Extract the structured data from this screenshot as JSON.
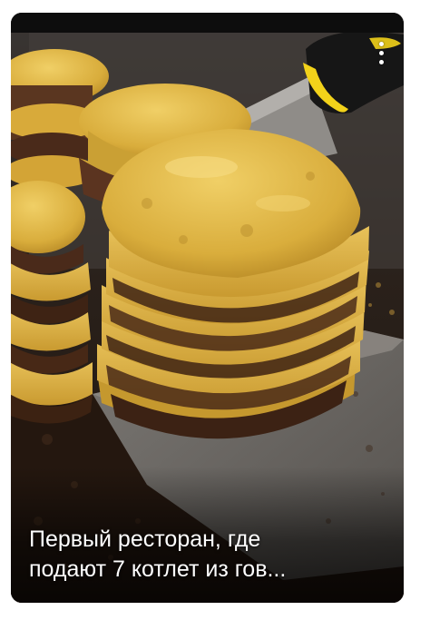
{
  "post": {
    "caption_line1": "Первый ресторан, где",
    "caption_line2": "подают 7 котлет из гов...",
    "image_subject": "stacked cheeseburger patties on a griddle with a spatula"
  },
  "menu": {
    "icon": "more-vertical-icon"
  },
  "colors": {
    "background": "#ffffff",
    "card": "#1a120c",
    "cheese": "#e0b640",
    "patty": "#4a2a1a",
    "griddle": "#6e6a66",
    "spatula_handle": "#1a1a1a",
    "spatula_accent": "#f2d21a"
  }
}
